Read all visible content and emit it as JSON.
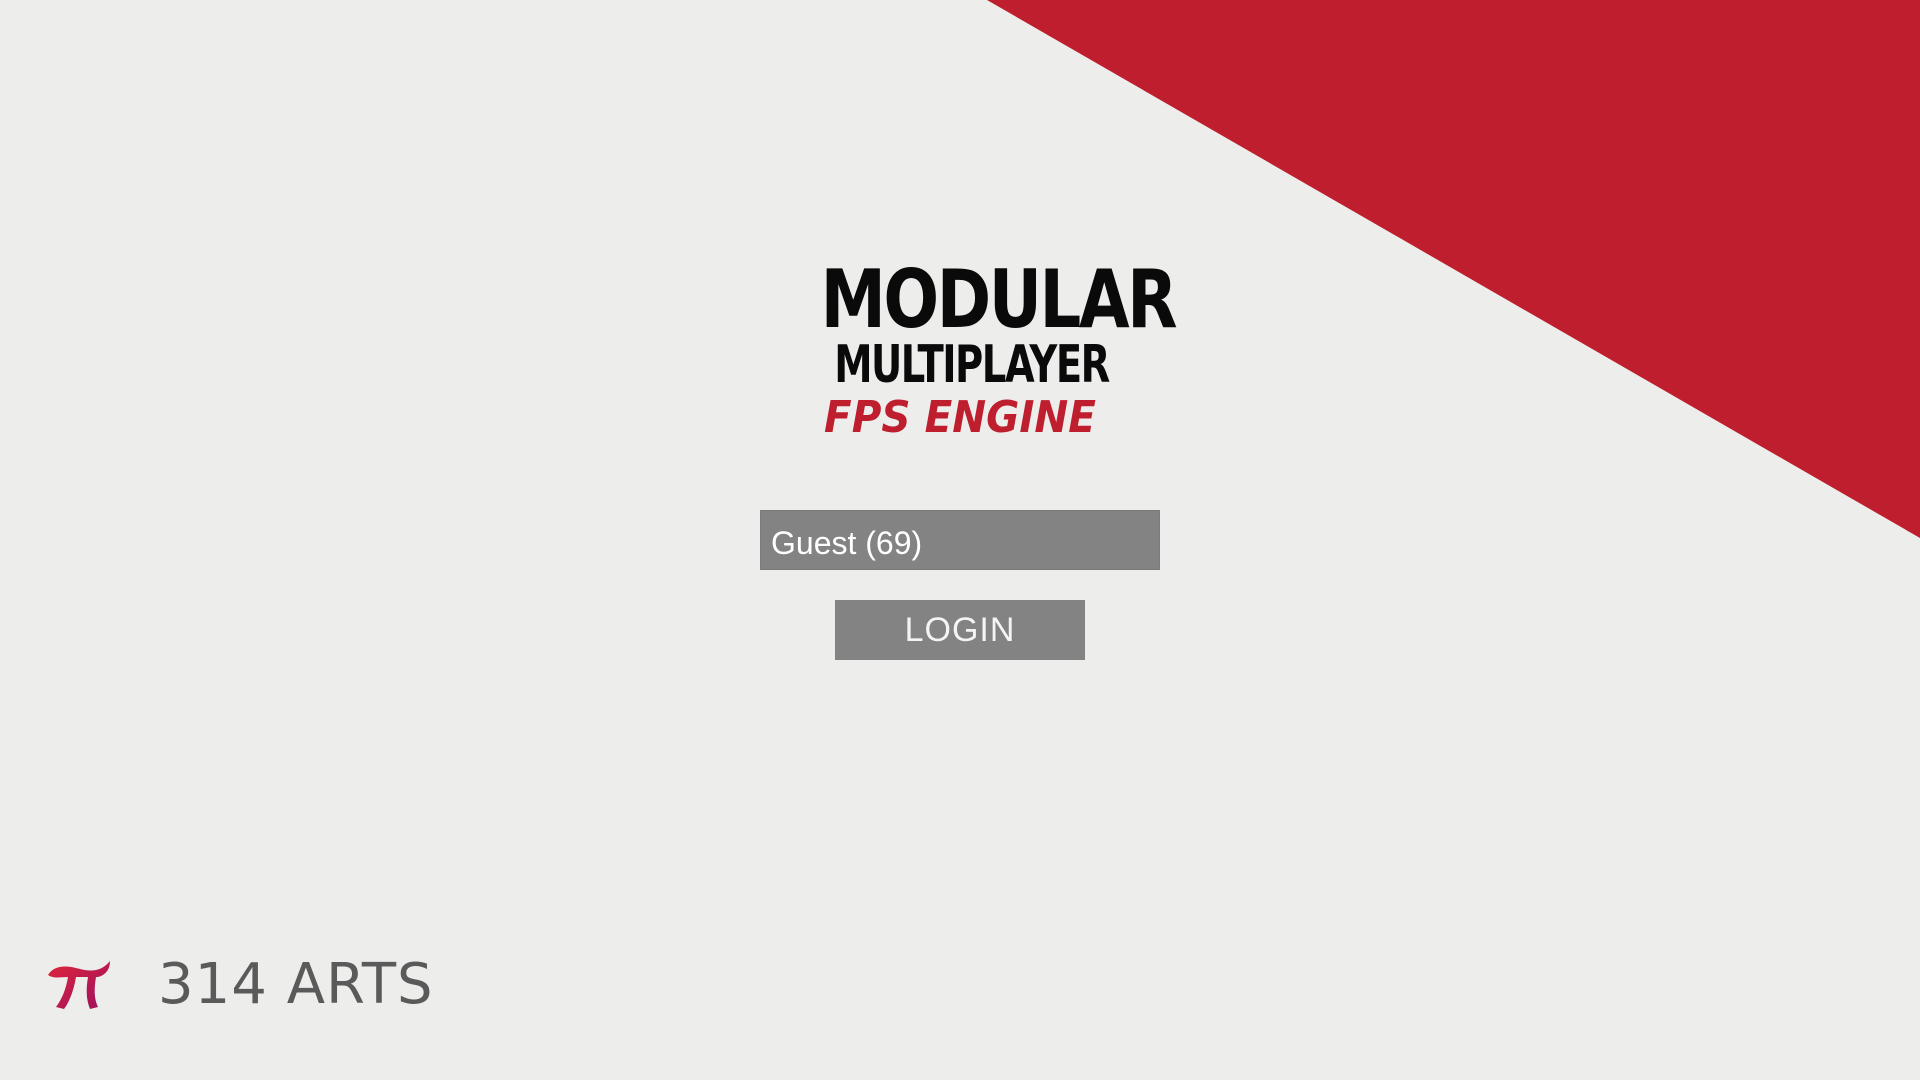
{
  "logo": {
    "line1": "MODULAR",
    "line2": "MULTIPLAYER",
    "line3": "FPS ENGINE"
  },
  "login": {
    "name_value": "Guest (69)",
    "button_label": "LOGIN"
  },
  "brand": {
    "icon": "pi-icon",
    "name": "314 ARTS"
  },
  "colors": {
    "background": "#edeeec",
    "accent_red": "#be1e2d",
    "field_gray": "#838383",
    "logo_black": "#0a0a0a",
    "brand_gray": "#5a5a5a"
  }
}
